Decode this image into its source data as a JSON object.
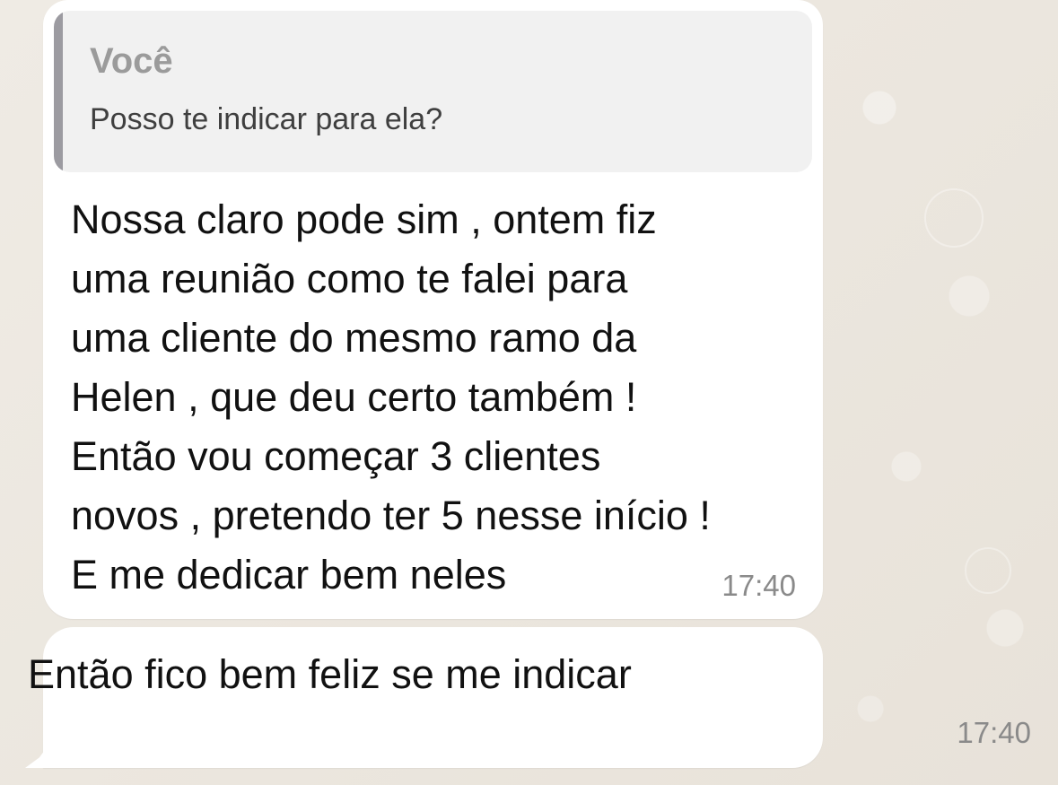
{
  "chat": {
    "messages": [
      {
        "reply": {
          "author": "Você",
          "text": "Posso te indicar para ela?"
        },
        "lines": [
          "Nossa claro pode sim , ontem fiz",
          "uma reunião como te falei para",
          "uma cliente do mesmo ramo da",
          "Helen , que deu certo também !",
          "Então vou começar 3 clientes",
          "novos , pretendo ter 5 nesse início !",
          "E me dedicar bem neles"
        ],
        "time": "17:40"
      },
      {
        "text": "Então fico bem feliz se me indicar",
        "time": "17:40"
      }
    ]
  },
  "colors": {
    "background": "#ece7df",
    "bubble": "#ffffff",
    "quote_background": "#f1f1f1",
    "quote_bar": "#9c9ba1",
    "timestamp": "#8a8a8a"
  }
}
